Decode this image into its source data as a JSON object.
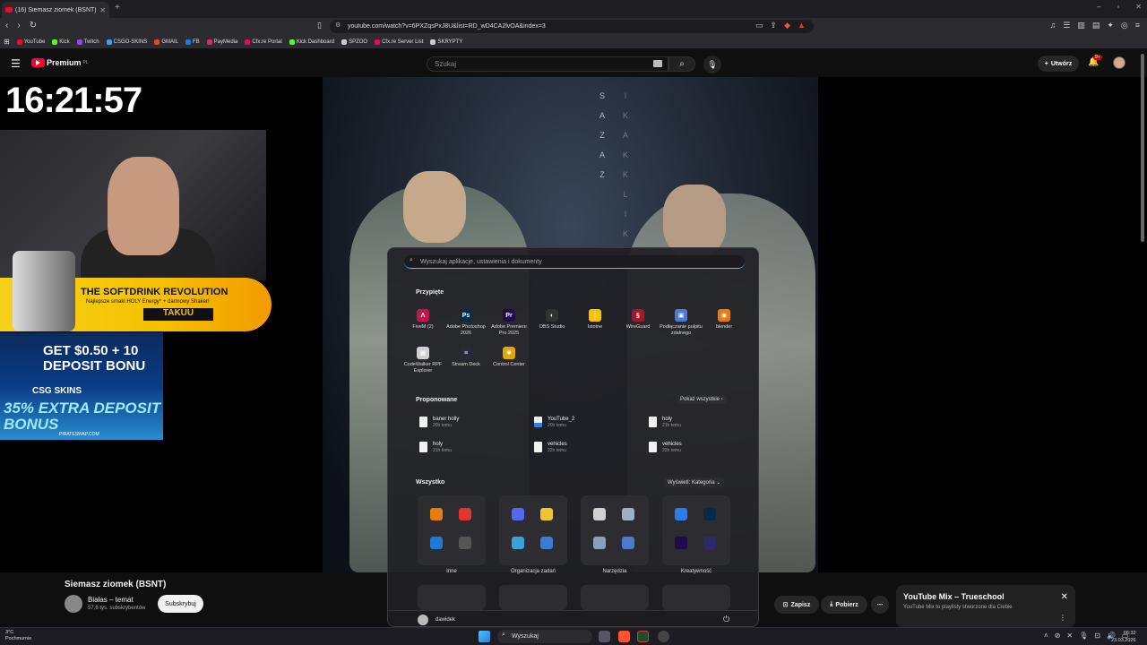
{
  "browser": {
    "tab_title": "(16) Siemasz ziomek (BSNT)",
    "url": "youtube.com/watch?v=6PXZqsPxJ8U&list=RD_wD4CA2lvOA&index=3",
    "bookmarks": [
      {
        "label": "YouTube",
        "color": "#ff0033"
      },
      {
        "label": "Kick",
        "color": "#53fc18"
      },
      {
        "label": "Twitch",
        "color": "#9146ff"
      },
      {
        "label": "CSGO-SKINS",
        "color": "#3aa0ff"
      },
      {
        "label": "GMAIL",
        "color": "#ea4335"
      },
      {
        "label": "FB",
        "color": "#1877f2"
      },
      {
        "label": "PayMedia",
        "color": "#e0245e"
      },
      {
        "label": "Cfx.re Portal",
        "color": "#f40552"
      },
      {
        "label": "Kick Dashboard",
        "color": "#53fc18"
      },
      {
        "label": "SPZOO",
        "color": "#cccccc"
      },
      {
        "label": "Cfx.re Server List",
        "color": "#f40552"
      },
      {
        "label": "SKRYPTY",
        "color": "#cccccc"
      }
    ]
  },
  "youtube": {
    "logo": "Premium",
    "logo_region": "PL",
    "search_placeholder": "Szukaj",
    "create_label": "Utwórz",
    "notif_count": "9+"
  },
  "overlay": {
    "clock": "16:21:57",
    "banner1_headline": "THE SOFTDRINK REVOLUTION",
    "banner1_sub": "Najlepsze smaki HOLY Energy* + darmowy Shaker!",
    "banner1_brand": "TAKUU",
    "banner2_promo": "GET $0.50 + 10 DEPOSIT BONU",
    "banner2_brand": "CSG SKINS",
    "banner2_extra": "35% EXTRA DEPOSIT BONUS",
    "banner2_site": "PIRATESWAP.COM"
  },
  "video": {
    "title": "Siemasz ziomek (BSNT)",
    "channel": "Białas – temat",
    "subscribers": "57,6 tys. subskrybentów",
    "subscribe_label": "Subskrybuj",
    "save_label": "Zapisz",
    "download_label": "Pobierz"
  },
  "mix": {
    "title": "YouTube Mix – Trueschool",
    "subtitle": "YouTube Mix to playlisty stworzone dla Ciebie"
  },
  "start_menu": {
    "search_placeholder": "Wyszukaj aplikacje, ustawienia i dokumenty",
    "pinned_title": "Przypięte",
    "pinned": [
      {
        "label": "FiveM (2)",
        "color": "#c0164f",
        "glyph": "Λ"
      },
      {
        "label": "Adobe Photoshop 2026",
        "color": "#0a2a4a",
        "glyph": "Ps"
      },
      {
        "label": "Adobe Premiere Pro 2025",
        "color": "#1f0a4a",
        "glyph": "Pr"
      },
      {
        "label": "OBS Studio",
        "color": "#333333",
        "glyph": "◐"
      },
      {
        "label": "Istotne",
        "color": "#f5c400",
        "glyph": "!"
      },
      {
        "label": "WireGuard",
        "color": "#a3162c",
        "glyph": "§"
      },
      {
        "label": "Podłączanie pulpitu zdalnego",
        "color": "#4a7bd0",
        "glyph": "▣"
      },
      {
        "label": "blender",
        "color": "#e87d0d",
        "glyph": "◉"
      },
      {
        "label": "CodeWalker RPF Explorer",
        "color": "#d0d0d0",
        "glyph": "▦"
      },
      {
        "label": "Stream Deck",
        "color": "#2a2a3a",
        "glyph": "≡"
      },
      {
        "label": "Control Center",
        "color": "#e0a800",
        "glyph": "✺"
      }
    ],
    "recommended_title": "Proponowane",
    "show_all": "Pokaż wszystkie",
    "recommended": [
      {
        "name": "baner holly",
        "time": "20h temu"
      },
      {
        "name": "YouTube_2",
        "time": "20h temu"
      },
      {
        "name": "holy",
        "time": "21h temu"
      },
      {
        "name": "holy",
        "time": "21h temu"
      },
      {
        "name": "vehicles",
        "time": "22h temu"
      },
      {
        "name": "vehicles",
        "time": "22h temu"
      }
    ],
    "all_title": "Wszystko",
    "view_label": "Wyświetl: Kategoria",
    "folders": [
      {
        "label": "Inne",
        "colors": [
          "#e87d0d",
          "#e2362a",
          "#1e7ad6",
          "#555555"
        ]
      },
      {
        "label": "Organizacja zadań",
        "colors": [
          "#5865f2",
          "#f0c330",
          "#3aa0d8",
          "#3a7bd5"
        ]
      },
      {
        "label": "Narzędzia",
        "colors": [
          "#d0d0d0",
          "#a0b0c0",
          "#8aa0b8",
          "#4a7bd0"
        ]
      },
      {
        "label": "Kreatywność",
        "colors": [
          "#2b7de9",
          "#0a2a4a",
          "#1f0a4a",
          "#2b2b6a"
        ]
      }
    ],
    "user": "dawidek"
  },
  "taskbar": {
    "temperature": "3°C",
    "weather": "Pochmurnie",
    "search_label": "Wyszukaj",
    "time": "06:32",
    "date": "23.03.2026"
  }
}
